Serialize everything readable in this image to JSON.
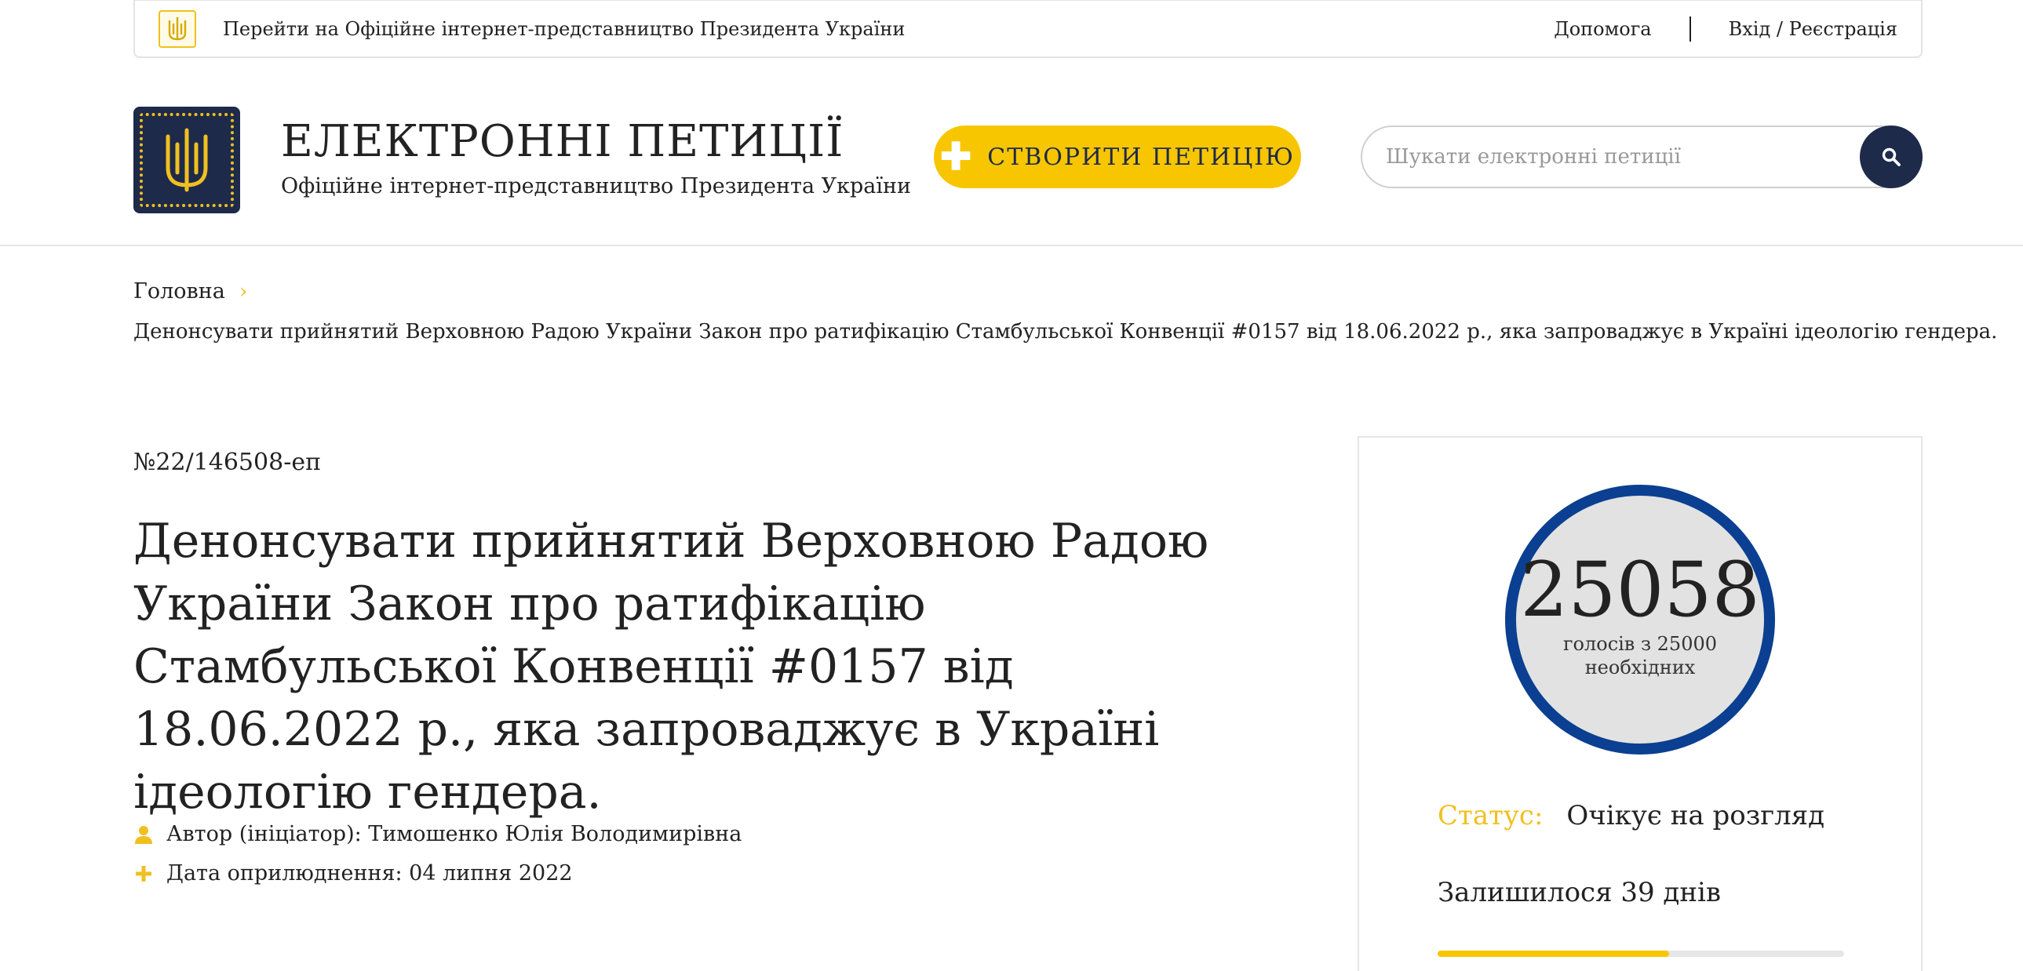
{
  "topbar": {
    "president_link": "Перейти на Офіційне інтернет-представництво Президента України",
    "help": "Допомога",
    "login": "Вхід / Реєстрація"
  },
  "header": {
    "title": "ЕЛЕКТРОННІ ПЕТИЦІЇ",
    "subtitle": "Офіційне інтернет-представництво Президента України",
    "create_button": "СТВОРИТИ ПЕТИЦІЮ",
    "search_placeholder": "Шукати електронні петиції"
  },
  "breadcrumb": {
    "home": "Головна",
    "current": "Денонсувати прийнятий Верховною Радою України Закон про ратифікацію Стамбульської Конвенції #0157 від 18.06.2022 р., яка запроваджує в Україні ідеологію гендера."
  },
  "petition": {
    "number": "№22/146508-еп",
    "title": "Денонсувати прийнятий Верховною Радою України Закон про ратифікацію Стамбульської Конвенції #0157 від 18.06.2022 р., яка запроваджує в Україні ідеологію гендера.",
    "author": "Автор (ініціатор): Тимошенко Юлія Володимирівна",
    "published": "Дата оприлюднення: 04 липня 2022"
  },
  "votes": {
    "count": "25058",
    "needed_text": "голосів з 25000 необхідних",
    "status_label": "Статус:",
    "status_value": "Очікує на розгляд",
    "remaining": "Залишилося 39 днів",
    "progress_fraction": 0.57
  },
  "colors": {
    "accent_yellow": "#f7c600",
    "navy": "#1e2a4a",
    "circle_blue": "#0b3f91"
  }
}
